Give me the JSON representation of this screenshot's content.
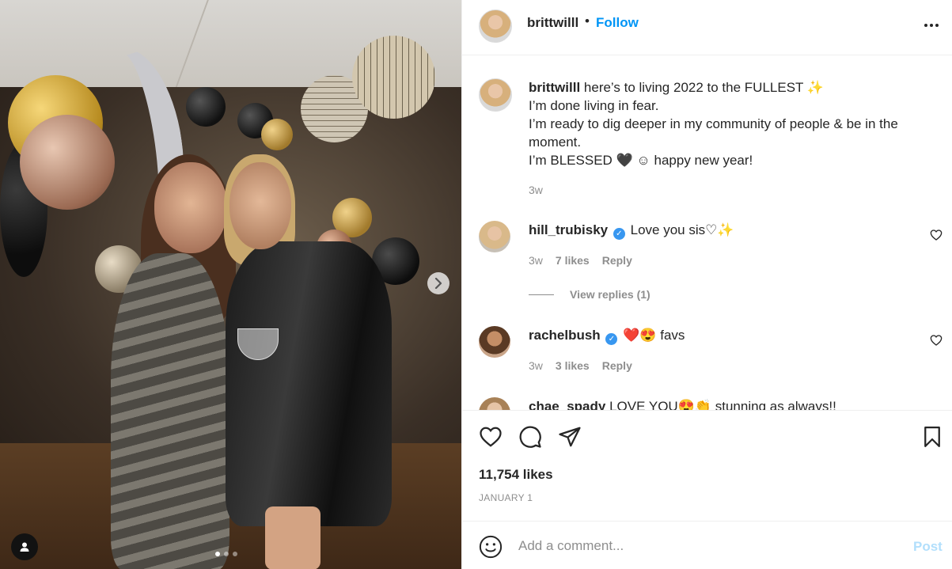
{
  "post": {
    "username": "brittwilll",
    "follow_label": "Follow",
    "caption_username": "brittwilll",
    "caption_lines": [
      "here’s to living 2022 to the FULLEST ✨",
      "I’m done living in fear.",
      "I’m ready to dig deeper in my community of people & be in the",
      "moment.",
      "I’m BLESSED 🖤 ☺ happy new year!"
    ],
    "caption_time": "3w"
  },
  "comments": [
    {
      "username": "hill_trubisky",
      "verified": true,
      "text": "Love you sis♡✨",
      "time": "3w",
      "likes": "7 likes",
      "reply": "Reply"
    },
    {
      "username": "rachelbush",
      "verified": true,
      "text": "❤️😍 favs",
      "time": "3w",
      "likes": "3 likes",
      "reply": "Reply"
    },
    {
      "username": "chae_spady",
      "verified": false,
      "text": "LOVE YOU😍👏 stunning as always!!"
    }
  ],
  "view_replies": "View replies (1)",
  "likes_count": "11,754 likes",
  "post_date": "JANUARY 1",
  "add_comment": {
    "placeholder": "Add a comment...",
    "post_label": "Post"
  },
  "carousel": {
    "total": 3,
    "active": 1
  },
  "colors": {
    "accent": "#0095f6",
    "post_disabled": "#b2dffc",
    "verified": "#3897f0"
  }
}
